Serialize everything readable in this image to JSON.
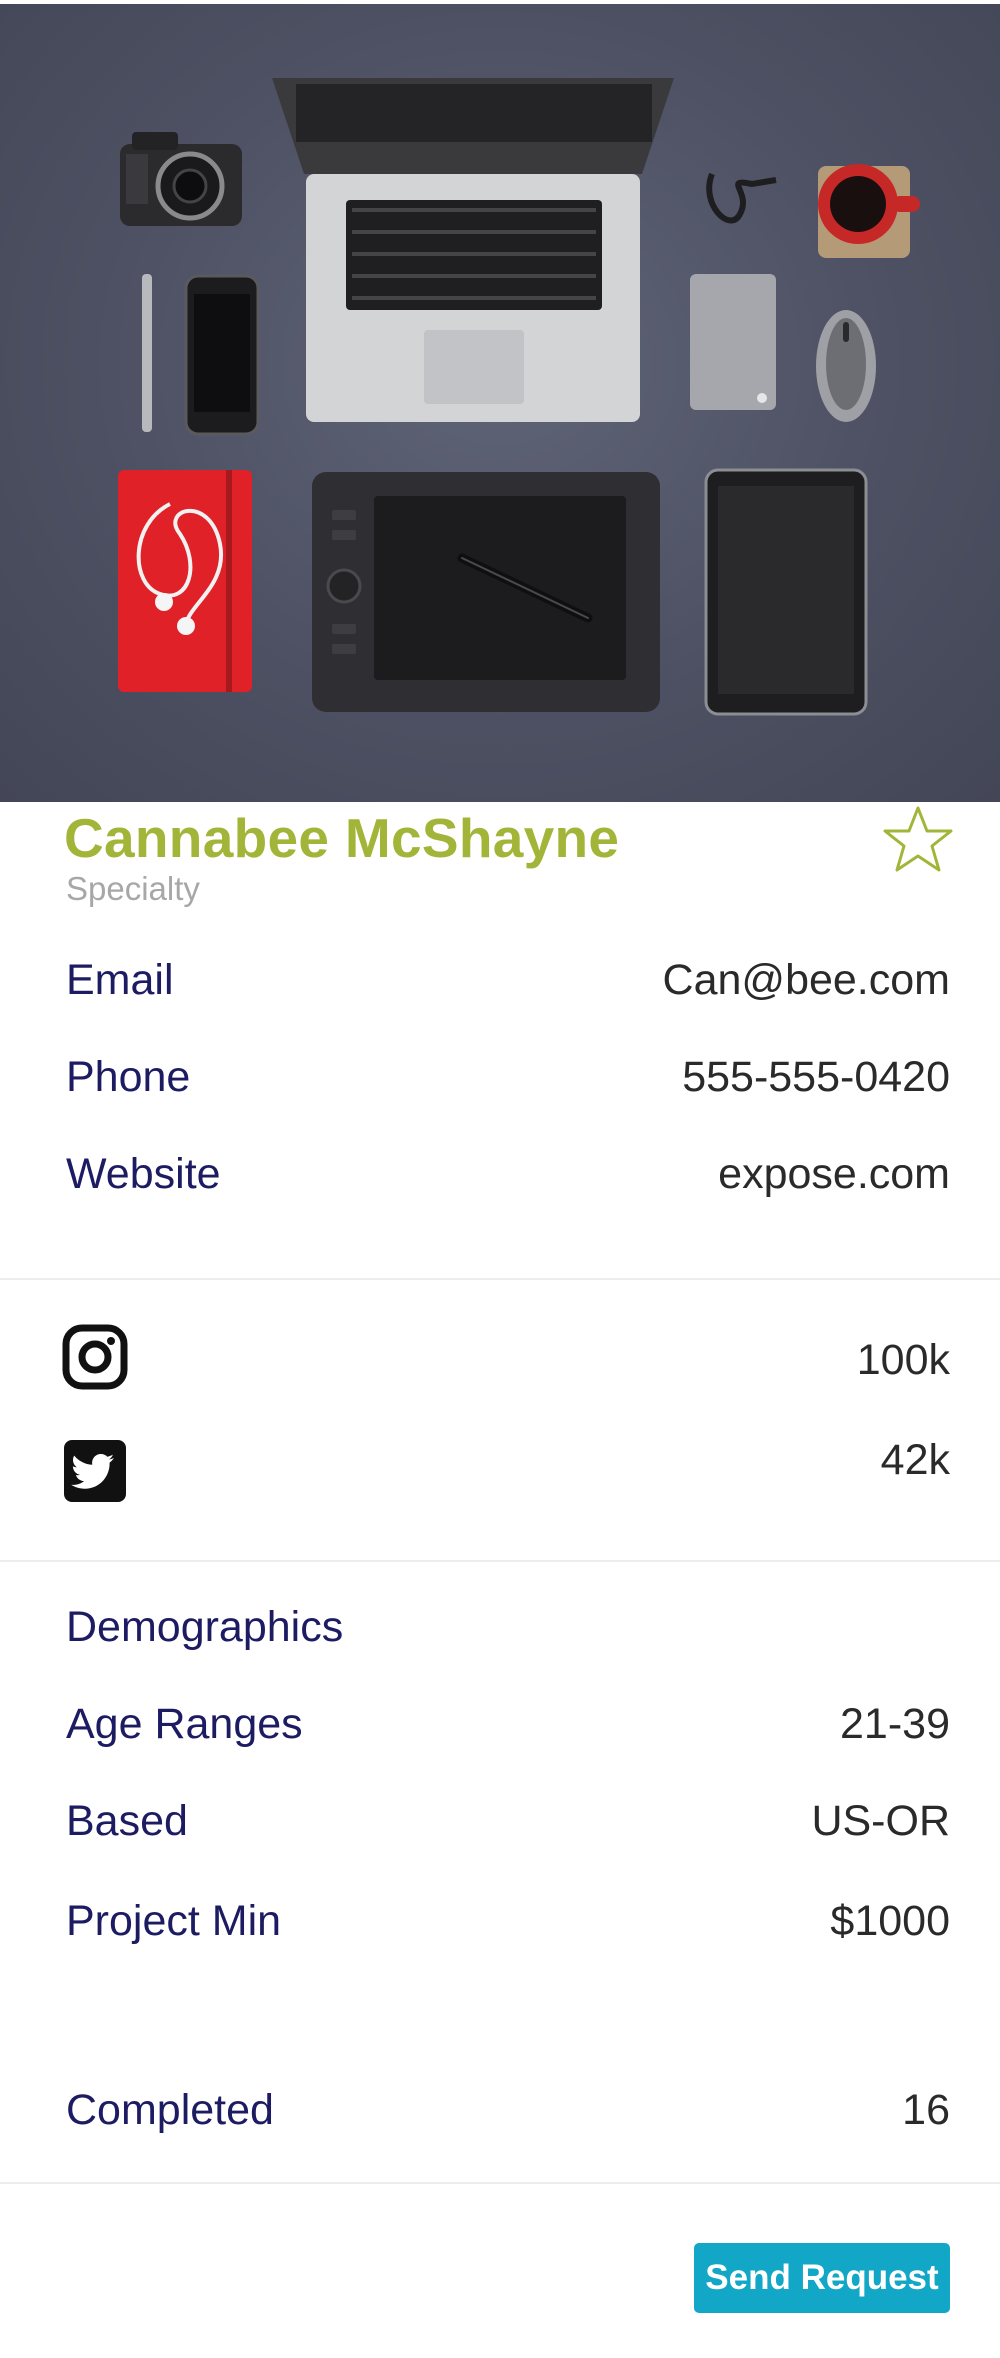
{
  "profile": {
    "name": "Cannabee McShayne",
    "specialty": "Specialty"
  },
  "contact": {
    "email_label": "Email",
    "email_value": "Can@bee.com",
    "phone_label": "Phone",
    "phone_value": "555-555-0420",
    "website_label": "Website",
    "website_value": "expose.com"
  },
  "social": {
    "instagram_icon": "instagram-icon",
    "instagram_value": "100k",
    "twitter_icon": "twitter-icon",
    "twitter_value": "42k"
  },
  "demographics": {
    "heading": "Demographics",
    "age_label": "Age Ranges",
    "age_value": "21-39",
    "based_label": "Based",
    "based_value": "US-OR",
    "project_min_label": "Project Min",
    "project_min_value": "$1000",
    "completed_label": "Completed",
    "completed_value": "16"
  },
  "actions": {
    "send_request_label": "Send Request"
  },
  "colors": {
    "name": "#a3b539",
    "label": "#1d1b62",
    "button": "#12a7c6"
  }
}
